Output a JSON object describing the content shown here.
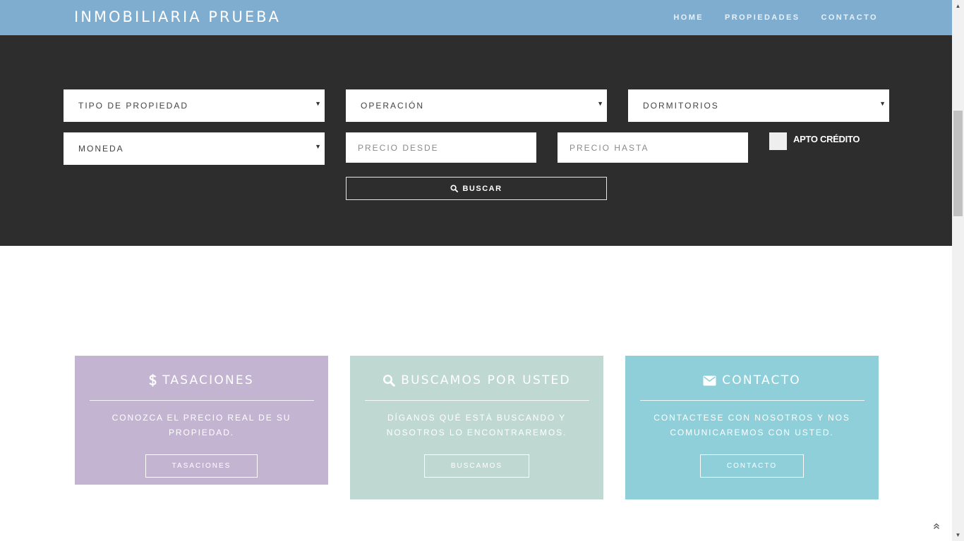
{
  "navbar": {
    "brand": "INMOBILIARIA PRUEBA",
    "links": [
      "HOME",
      "PROPIEDADES",
      "CONTACTO"
    ]
  },
  "search": {
    "tipo_propiedad": "TIPO DE PROPIEDAD",
    "operacion": "OPERACIÓN",
    "dormitorios": "DORMITORIOS",
    "moneda": "MONEDA",
    "precio_desde_placeholder": "PRECIO DESDE",
    "precio_hasta_placeholder": "PRECIO HASTA",
    "apto_credito": "APTO CRÉDITO",
    "buscar": "BUSCAR"
  },
  "cards": [
    {
      "title": "TASACIONES",
      "icon": "dollar-icon",
      "text": "CONOZCA EL PRECIO REAL DE SU PROPIEDAD.",
      "button": "TASACIONES",
      "color": "#c3b4d2"
    },
    {
      "title": "BUSCAMOS POR USTED",
      "icon": "search-icon",
      "text": "DÍGANOS QUÉ ESTÁ BUSCANDO Y NOSOTROS LO ENCONTRAREMOS.",
      "button": "BUSCAMOS",
      "color": "#bfd8d2"
    },
    {
      "title": "CONTACTO",
      "icon": "envelope-icon",
      "text": "CONTACTESE CON NOSOTROS Y NOS COMUNICAREMOS CON USTED.",
      "button": "CONTACTO",
      "color": "#8ecfd9"
    }
  ],
  "colors": {
    "navbar": "#7fadd0",
    "search_bg": "#2d2d2d"
  }
}
